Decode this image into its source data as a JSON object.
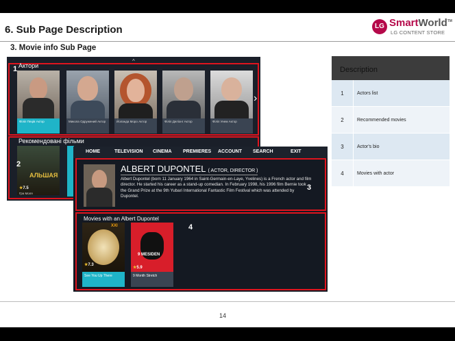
{
  "slide": {
    "title": "6. Sub Page Description",
    "subtitle": "3. Movie info Sub Page",
    "page_number": "14"
  },
  "logo": {
    "badge": "LG",
    "smart": "Smart",
    "world": "World",
    "tm": "TM",
    "store": "LG CONTENT STORE"
  },
  "screen1": {
    "actors_label": "Актори",
    "recommended_label": "Рекомендовані фільми",
    "actors": [
      {
        "caption": "Філіп Пеців Актор"
      },
      {
        "caption": "Микола Одружений Актор"
      },
      {
        "caption": "Йоланда Моро Актор"
      },
      {
        "caption": "Філіп Деліонг Актор"
      },
      {
        "caption": "Філіп Унем Актор"
      }
    ],
    "recommended_movie": {
      "rating": "7.5",
      "caption": "Гра Моля",
      "overlay": "АЛЬШАЯ"
    },
    "chevron_up": "^",
    "chevron_right": "›"
  },
  "screen2": {
    "nav": [
      "HOME",
      "TELEVISION",
      "CINEMA",
      "PREMIERES",
      "ACCOUNT",
      "SEARCH",
      "EXIT"
    ],
    "actor_name": "ALBERT DUPONTEL",
    "actor_role": "( ACTOR, DIRECTOR )",
    "bio": "Albert Dupontel (born 11 January 1964 in Saint-Germain-en-Laye, Yvelines) is a French actor and film director. He started his career as a stand-up comedian. In February 1998, his 1996 film Bernie took the Grand Prize at the 9th Yubari International Fantastic Film Festival which was attended by Dupontel.",
    "movies_label": "Movies with an Albert Dupontel",
    "movies": [
      {
        "rating": "7.3",
        "caption": "See You Up There",
        "badge": "XXI"
      },
      {
        "rating": "5.9",
        "caption": "9 Month Stretch",
        "overlay": "9 MESIDEN"
      }
    ]
  },
  "markers": [
    "1",
    "2",
    "3",
    "4"
  ],
  "description_table": {
    "header": "Description",
    "rows": [
      {
        "num": "1",
        "text": "Actors list"
      },
      {
        "num": "2",
        "text": "Recommended movies"
      },
      {
        "num": "3",
        "text": "Actor's bio"
      },
      {
        "num": "4",
        "text": "Movies with actor"
      }
    ]
  },
  "colors": {
    "highlight": "#e0141e",
    "brand": "#b5094a",
    "selected": "#1fb4c8"
  }
}
